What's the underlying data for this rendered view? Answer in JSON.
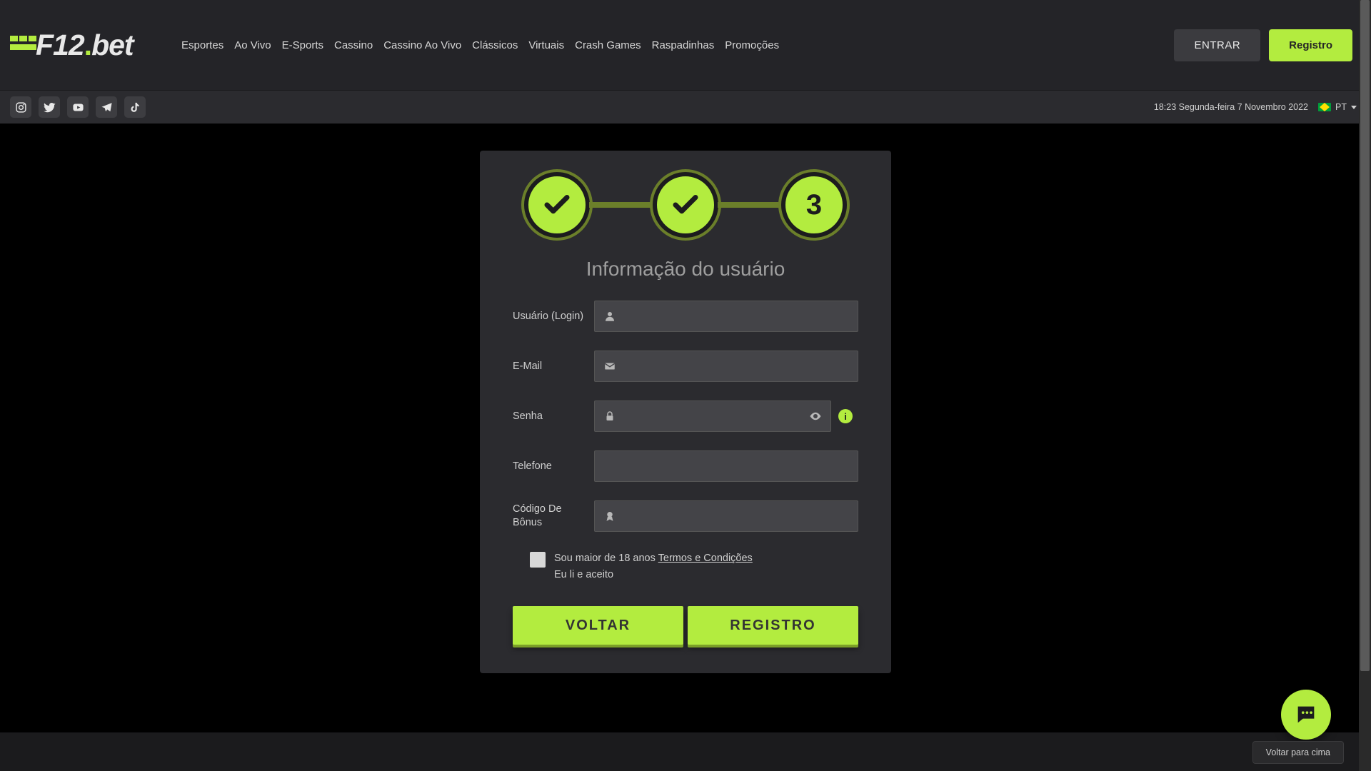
{
  "brand": {
    "name": "F12.bet"
  },
  "nav": {
    "items": [
      "Esportes",
      "Ao Vivo",
      "E-Sports",
      "Cassino",
      "Cassino Ao Vivo",
      "Clássicos",
      "Virtuais",
      "Crash Games",
      "Raspadinhas",
      "Promoções"
    ]
  },
  "header": {
    "login": "ENTRAR",
    "register": "Registro"
  },
  "subheader": {
    "datetime": "18:23 Segunda-feira 7 Novembro 2022",
    "language": "PT"
  },
  "form": {
    "step_current_label": "3",
    "title": "Informação do usuário",
    "fields": {
      "user": {
        "label": "Usuário (Login)"
      },
      "email": {
        "label": "E-Mail"
      },
      "senha": {
        "label": "Senha"
      },
      "telefone": {
        "label": "Telefone"
      },
      "bonus": {
        "label": "Código De Bônus"
      }
    },
    "consent": {
      "age": "Sou maior de 18 anos ",
      "terms_link": "Termos e Condições",
      "read": "Eu li e aceito"
    },
    "buttons": {
      "back": "VOLTAR",
      "submit": "REGISTRO"
    }
  },
  "misc": {
    "back_to_top": "Voltar para cima",
    "info_glyph": "i"
  }
}
